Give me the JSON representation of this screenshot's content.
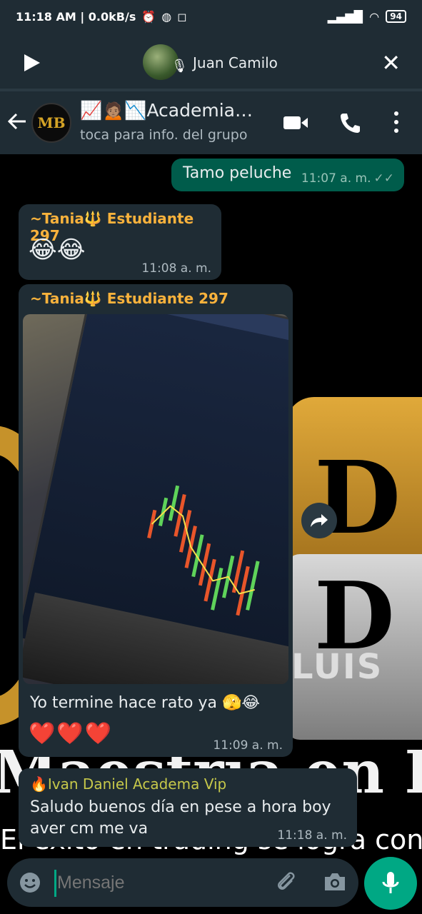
{
  "status_bar": {
    "time_info": "11:18 AM | 0.0kB/s",
    "battery": "94"
  },
  "player": {
    "name": "Juan Camilo"
  },
  "chat_header": {
    "title": "📈🙍🏽📉Academia…",
    "subtitle": "toca para info. del grupo",
    "avatar_text": "MB"
  },
  "messages": [
    {
      "type": "outgoing",
      "text": "Tamo peluche",
      "time": "11:07 a. m.",
      "status": "read"
    },
    {
      "type": "incoming",
      "sender": "~Tania🔱 Estudiante 297",
      "text": "😂😂",
      "time": "11:08 a. m."
    },
    {
      "type": "incoming",
      "sender": "~Tania🔱 Estudiante 297",
      "has_photo": true,
      "text": "Yo termine hace rato ya 🫣😂",
      "hearts": "❤️❤️❤️",
      "time": "11:09 a. m."
    },
    {
      "type": "incoming",
      "sender": "🔥Ivan Daniel Academa Vip",
      "text": "Saludo buenos día en pese a hora boy aver cm me va",
      "time": "11:18 a. m."
    }
  ],
  "wallpaper": {
    "big_text": "Maestría en Binar",
    "small_text": "El éxito en trading se logra con conocimie",
    "brand_text": "LUIS"
  },
  "input": {
    "placeholder": "Mensaje"
  },
  "colors": {
    "header_bg": "#1f2c34",
    "outgoing_bubble": "#005c4b",
    "incoming_bubble": "#1f2c34",
    "accent": "#00a884",
    "sender_name": "#f9b23c"
  }
}
